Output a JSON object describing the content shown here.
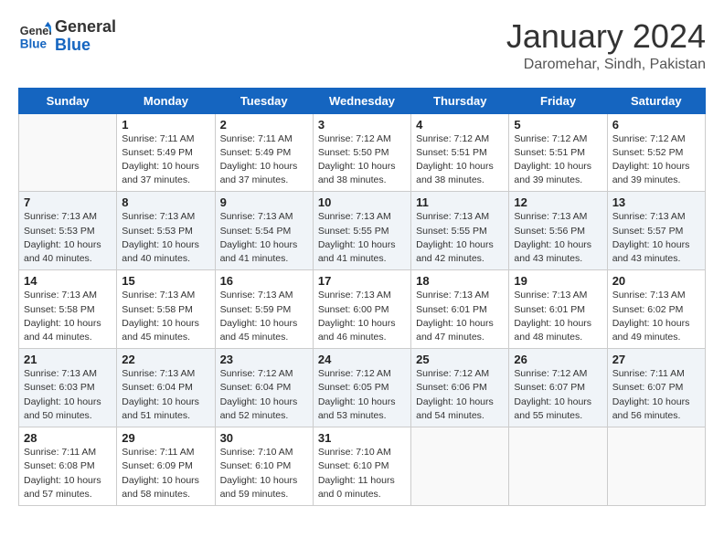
{
  "logo": {
    "line1": "General",
    "line2": "Blue"
  },
  "title": "January 2024",
  "subtitle": "Daromehar, Sindh, Pakistan",
  "days_of_week": [
    "Sunday",
    "Monday",
    "Tuesday",
    "Wednesday",
    "Thursday",
    "Friday",
    "Saturday"
  ],
  "weeks": [
    [
      {
        "num": "",
        "info": ""
      },
      {
        "num": "1",
        "info": "Sunrise: 7:11 AM\nSunset: 5:49 PM\nDaylight: 10 hours\nand 37 minutes."
      },
      {
        "num": "2",
        "info": "Sunrise: 7:11 AM\nSunset: 5:49 PM\nDaylight: 10 hours\nand 37 minutes."
      },
      {
        "num": "3",
        "info": "Sunrise: 7:12 AM\nSunset: 5:50 PM\nDaylight: 10 hours\nand 38 minutes."
      },
      {
        "num": "4",
        "info": "Sunrise: 7:12 AM\nSunset: 5:51 PM\nDaylight: 10 hours\nand 38 minutes."
      },
      {
        "num": "5",
        "info": "Sunrise: 7:12 AM\nSunset: 5:51 PM\nDaylight: 10 hours\nand 39 minutes."
      },
      {
        "num": "6",
        "info": "Sunrise: 7:12 AM\nSunset: 5:52 PM\nDaylight: 10 hours\nand 39 minutes."
      }
    ],
    [
      {
        "num": "7",
        "info": "Sunrise: 7:13 AM\nSunset: 5:53 PM\nDaylight: 10 hours\nand 40 minutes."
      },
      {
        "num": "8",
        "info": "Sunrise: 7:13 AM\nSunset: 5:53 PM\nDaylight: 10 hours\nand 40 minutes."
      },
      {
        "num": "9",
        "info": "Sunrise: 7:13 AM\nSunset: 5:54 PM\nDaylight: 10 hours\nand 41 minutes."
      },
      {
        "num": "10",
        "info": "Sunrise: 7:13 AM\nSunset: 5:55 PM\nDaylight: 10 hours\nand 41 minutes."
      },
      {
        "num": "11",
        "info": "Sunrise: 7:13 AM\nSunset: 5:55 PM\nDaylight: 10 hours\nand 42 minutes."
      },
      {
        "num": "12",
        "info": "Sunrise: 7:13 AM\nSunset: 5:56 PM\nDaylight: 10 hours\nand 43 minutes."
      },
      {
        "num": "13",
        "info": "Sunrise: 7:13 AM\nSunset: 5:57 PM\nDaylight: 10 hours\nand 43 minutes."
      }
    ],
    [
      {
        "num": "14",
        "info": "Sunrise: 7:13 AM\nSunset: 5:58 PM\nDaylight: 10 hours\nand 44 minutes."
      },
      {
        "num": "15",
        "info": "Sunrise: 7:13 AM\nSunset: 5:58 PM\nDaylight: 10 hours\nand 45 minutes."
      },
      {
        "num": "16",
        "info": "Sunrise: 7:13 AM\nSunset: 5:59 PM\nDaylight: 10 hours\nand 45 minutes."
      },
      {
        "num": "17",
        "info": "Sunrise: 7:13 AM\nSunset: 6:00 PM\nDaylight: 10 hours\nand 46 minutes."
      },
      {
        "num": "18",
        "info": "Sunrise: 7:13 AM\nSunset: 6:01 PM\nDaylight: 10 hours\nand 47 minutes."
      },
      {
        "num": "19",
        "info": "Sunrise: 7:13 AM\nSunset: 6:01 PM\nDaylight: 10 hours\nand 48 minutes."
      },
      {
        "num": "20",
        "info": "Sunrise: 7:13 AM\nSunset: 6:02 PM\nDaylight: 10 hours\nand 49 minutes."
      }
    ],
    [
      {
        "num": "21",
        "info": "Sunrise: 7:13 AM\nSunset: 6:03 PM\nDaylight: 10 hours\nand 50 minutes."
      },
      {
        "num": "22",
        "info": "Sunrise: 7:13 AM\nSunset: 6:04 PM\nDaylight: 10 hours\nand 51 minutes."
      },
      {
        "num": "23",
        "info": "Sunrise: 7:12 AM\nSunset: 6:04 PM\nDaylight: 10 hours\nand 52 minutes."
      },
      {
        "num": "24",
        "info": "Sunrise: 7:12 AM\nSunset: 6:05 PM\nDaylight: 10 hours\nand 53 minutes."
      },
      {
        "num": "25",
        "info": "Sunrise: 7:12 AM\nSunset: 6:06 PM\nDaylight: 10 hours\nand 54 minutes."
      },
      {
        "num": "26",
        "info": "Sunrise: 7:12 AM\nSunset: 6:07 PM\nDaylight: 10 hours\nand 55 minutes."
      },
      {
        "num": "27",
        "info": "Sunrise: 7:11 AM\nSunset: 6:07 PM\nDaylight: 10 hours\nand 56 minutes."
      }
    ],
    [
      {
        "num": "28",
        "info": "Sunrise: 7:11 AM\nSunset: 6:08 PM\nDaylight: 10 hours\nand 57 minutes."
      },
      {
        "num": "29",
        "info": "Sunrise: 7:11 AM\nSunset: 6:09 PM\nDaylight: 10 hours\nand 58 minutes."
      },
      {
        "num": "30",
        "info": "Sunrise: 7:10 AM\nSunset: 6:10 PM\nDaylight: 10 hours\nand 59 minutes."
      },
      {
        "num": "31",
        "info": "Sunrise: 7:10 AM\nSunset: 6:10 PM\nDaylight: 11 hours\nand 0 minutes."
      },
      {
        "num": "",
        "info": ""
      },
      {
        "num": "",
        "info": ""
      },
      {
        "num": "",
        "info": ""
      }
    ]
  ]
}
